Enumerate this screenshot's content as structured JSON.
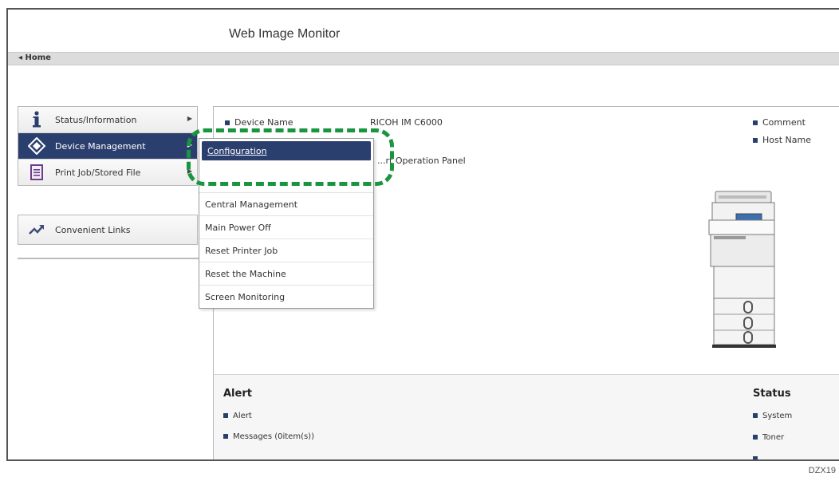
{
  "app": {
    "title": "Web Image Monitor"
  },
  "breadcrumb": {
    "home": "◂ Home"
  },
  "nav": {
    "items": [
      {
        "label": "Status/Information",
        "icon": "info-icon"
      },
      {
        "label": "Device Management",
        "icon": "device-management-icon"
      },
      {
        "label": "Print Job/Stored File",
        "icon": "document-icon"
      }
    ],
    "links": {
      "label": "Convenient Links",
      "icon": "link-arrow-icon"
    }
  },
  "dropdown": {
    "items": [
      "Configuration",
      "Central Management",
      "Main Power Off",
      "Reset Printer Job",
      "Reset the Machine",
      "Screen Monitoring"
    ]
  },
  "device": {
    "name_label": "Device Name",
    "name_value": "RICOH IM C6000",
    "partial_text": "...rt Operation Panel",
    "right_labels": [
      "Comment",
      "Host Name"
    ]
  },
  "alert": {
    "heading": "Alert",
    "items": [
      "Alert",
      "Messages (0item(s))"
    ]
  },
  "status": {
    "heading": "Status",
    "items": [
      "System",
      "Toner"
    ]
  },
  "caption": "DZX19",
  "colors": {
    "accent": "#2b3f6e",
    "highlight": "#199540"
  }
}
